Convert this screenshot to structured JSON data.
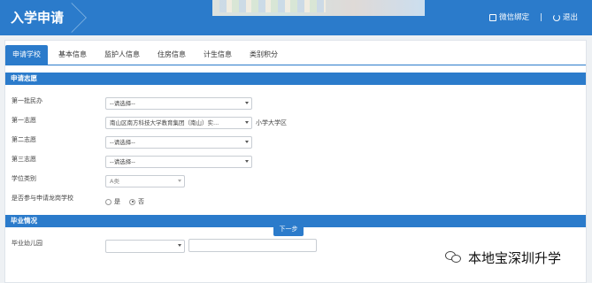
{
  "header": {
    "title": "入学申请",
    "wechat_bind_label": "微信绑定",
    "divider": "|",
    "logout_label": "退出",
    "accent_color": "#2b7bcb"
  },
  "tabs": [
    {
      "label": "申请学校",
      "active": true
    },
    {
      "label": "基本信息",
      "active": false
    },
    {
      "label": "监护人信息",
      "active": false
    },
    {
      "label": "住房信息",
      "active": false
    },
    {
      "label": "计生信息",
      "active": false
    },
    {
      "label": "类别积分",
      "active": false
    }
  ],
  "sections": {
    "application": {
      "title": "申请志愿",
      "fields": [
        {
          "label": "第一批民办",
          "value": "--请选择--"
        },
        {
          "label": "第一志愿",
          "value": "南山区南方科技大学教育集团（南山）实...",
          "note": "小学大学区"
        },
        {
          "label": "第二志愿",
          "value": "--请选择--"
        },
        {
          "label": "第三志愿",
          "value": "--请选择--"
        },
        {
          "label": "学位类别",
          "value": "A类"
        }
      ],
      "dragon_school": {
        "label": "是否参与申请龙岗学校",
        "options": [
          "是",
          "否"
        ],
        "selected": "否"
      }
    },
    "graduation": {
      "title": "毕业情况",
      "kindergarten_label": "毕业幼儿园",
      "kindergarten_select_value": "",
      "kindergarten_input_value": ""
    }
  },
  "next_button_label": "下一步",
  "watermark": "本地宝深圳升学"
}
